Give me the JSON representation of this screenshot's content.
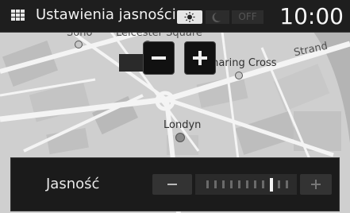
{
  "header": {
    "title": "Ustawienia jasności",
    "time": "10:00",
    "mode_buttons": {
      "sun_icon": "sun-icon",
      "moon_icon": "moon-icon",
      "off_label": "OFF"
    }
  },
  "map": {
    "labels": {
      "soho": "Soho",
      "leicester": "Leicester Square",
      "charing": "Charing Cross",
      "strand": "Strand",
      "london": "Londyn"
    },
    "zoom_out_icon": "minus-icon",
    "zoom_in_icon": "plus-icon"
  },
  "brightness": {
    "label": "Jasność",
    "level_fraction": 0.8,
    "steps": 11,
    "minus_icon": "minus-icon",
    "plus_icon": "plus-icon"
  },
  "colors": {
    "map_background": "#cfcfcf",
    "road": "#f4f4f4",
    "bar_background": "#1e1e1e",
    "panel_background": "#1b1b1b"
  }
}
